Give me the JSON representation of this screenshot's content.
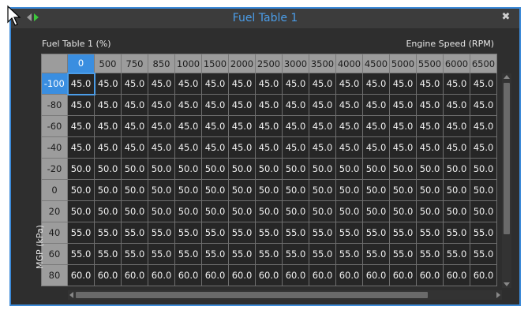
{
  "window": {
    "title": "Fuel Table 1",
    "close_glyph": "✖",
    "accent_color": "#3c8ad8"
  },
  "labels": {
    "table_name": "Fuel Table 1 (%)",
    "x_axis": "Engine Speed (RPM)",
    "y_axis": "MGP (kPa)"
  },
  "columns": [
    "0",
    "500",
    "750",
    "850",
    "1000",
    "1500",
    "2000",
    "2500",
    "3000",
    "3500",
    "4000",
    "4500",
    "5000",
    "5500",
    "6000",
    "6500"
  ],
  "rows": [
    {
      "label": "-100",
      "value": "45.0"
    },
    {
      "label": "-80",
      "value": "45.0"
    },
    {
      "label": "-60",
      "value": "45.0"
    },
    {
      "label": "-40",
      "value": "45.0"
    },
    {
      "label": "-20",
      "value": "50.0"
    },
    {
      "label": "0",
      "value": "50.0"
    },
    {
      "label": "20",
      "value": "50.0"
    },
    {
      "label": "40",
      "value": "55.0"
    },
    {
      "label": "60",
      "value": "55.0"
    },
    {
      "label": "80",
      "value": "60.0"
    }
  ],
  "selection": {
    "row": 0,
    "col": 0
  }
}
